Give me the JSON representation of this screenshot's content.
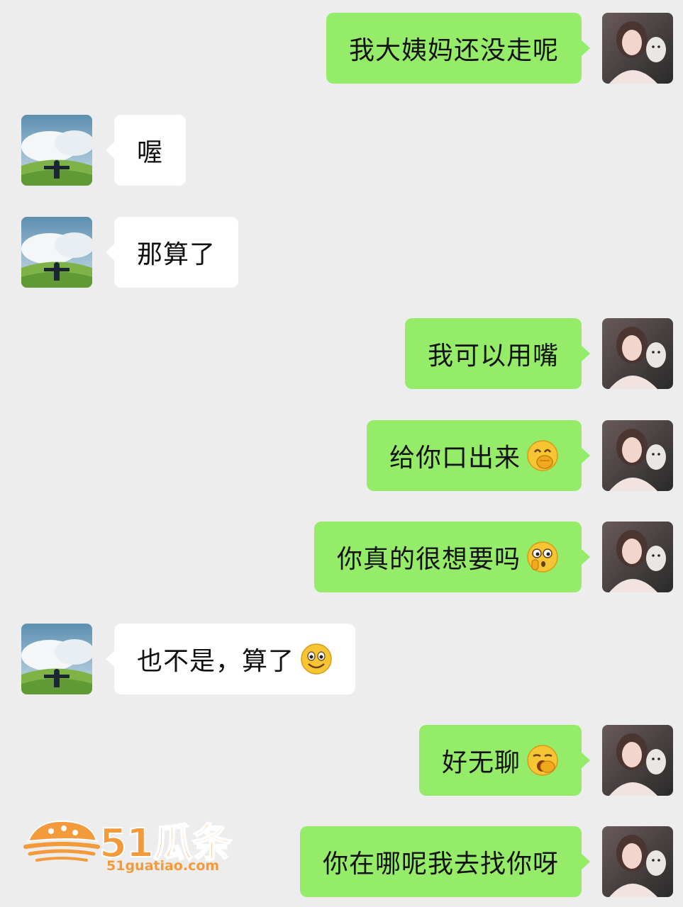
{
  "messages": [
    {
      "side": "me",
      "text": "我大姨妈还没走呢"
    },
    {
      "side": "other",
      "text": "喔"
    },
    {
      "side": "other",
      "text": "那算了"
    },
    {
      "side": "me",
      "text": "我可以用嘴"
    },
    {
      "side": "me",
      "text": "给你口出来",
      "emoji": "giggle-emoji"
    },
    {
      "side": "me",
      "text": "你真的很想要吗",
      "emoji": "shocked-emoji"
    },
    {
      "side": "other",
      "text": "也不是，算了",
      "emoji": "smile-emoji"
    },
    {
      "side": "me",
      "text": "好无聊",
      "emoji": "yawn-emoji"
    },
    {
      "side": "me",
      "text": "你在哪呢我去找你呀"
    }
  ],
  "watermark": {
    "brand": "51瓜条",
    "url": "51guatiao.com"
  },
  "colors": {
    "background": "#ededed",
    "me_bubble": "#95ec69",
    "other_bubble": "#ffffff",
    "watermark": "#f39a3a"
  }
}
